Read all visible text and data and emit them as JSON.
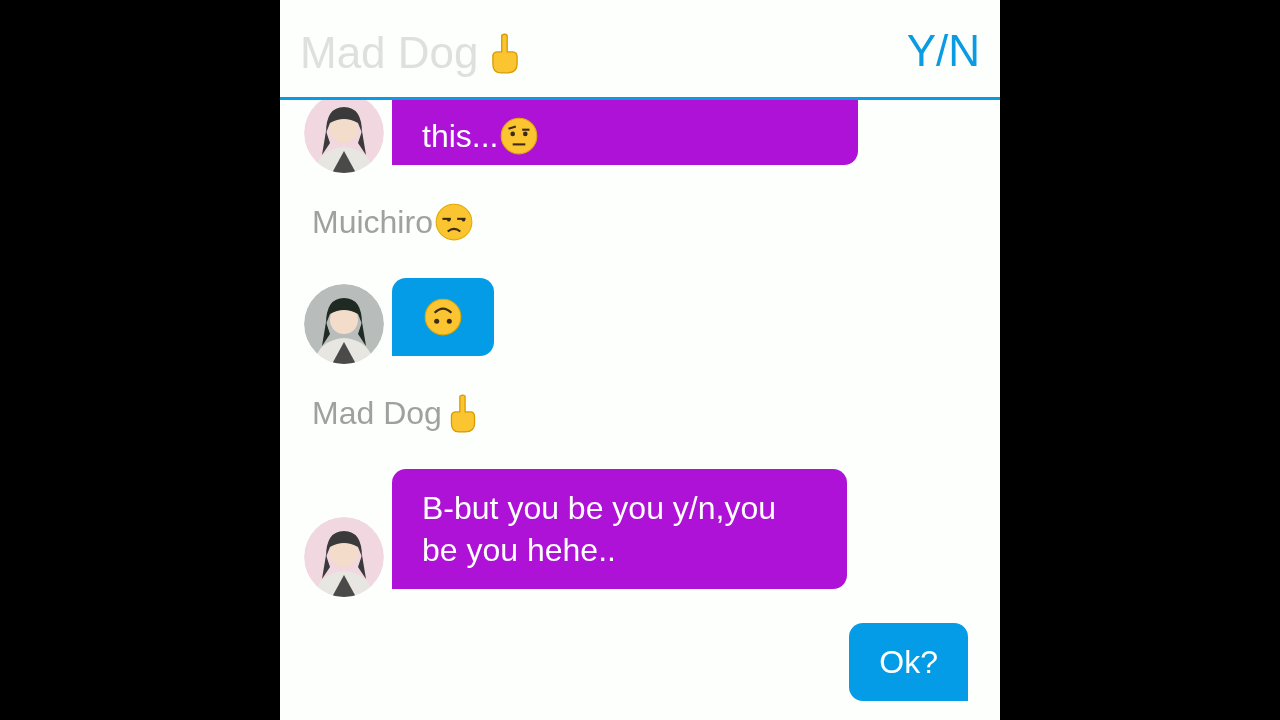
{
  "header": {
    "title": "Mad Dog",
    "other_name": "Y/N"
  },
  "feed": [
    {
      "kind": "incoming",
      "color": "#ad12d6",
      "text": "this..."
    },
    {
      "kind": "name",
      "text": "Muichiro"
    },
    {
      "kind": "incoming",
      "color": "#049ce6"
    },
    {
      "kind": "name",
      "text": "Mad Dog"
    },
    {
      "kind": "incoming",
      "color": "#ad12d6",
      "text": "B-but you be you y/n,you be you hehe.."
    },
    {
      "kind": "outgoing",
      "color": "#049ce6",
      "text": "Ok?"
    }
  ]
}
